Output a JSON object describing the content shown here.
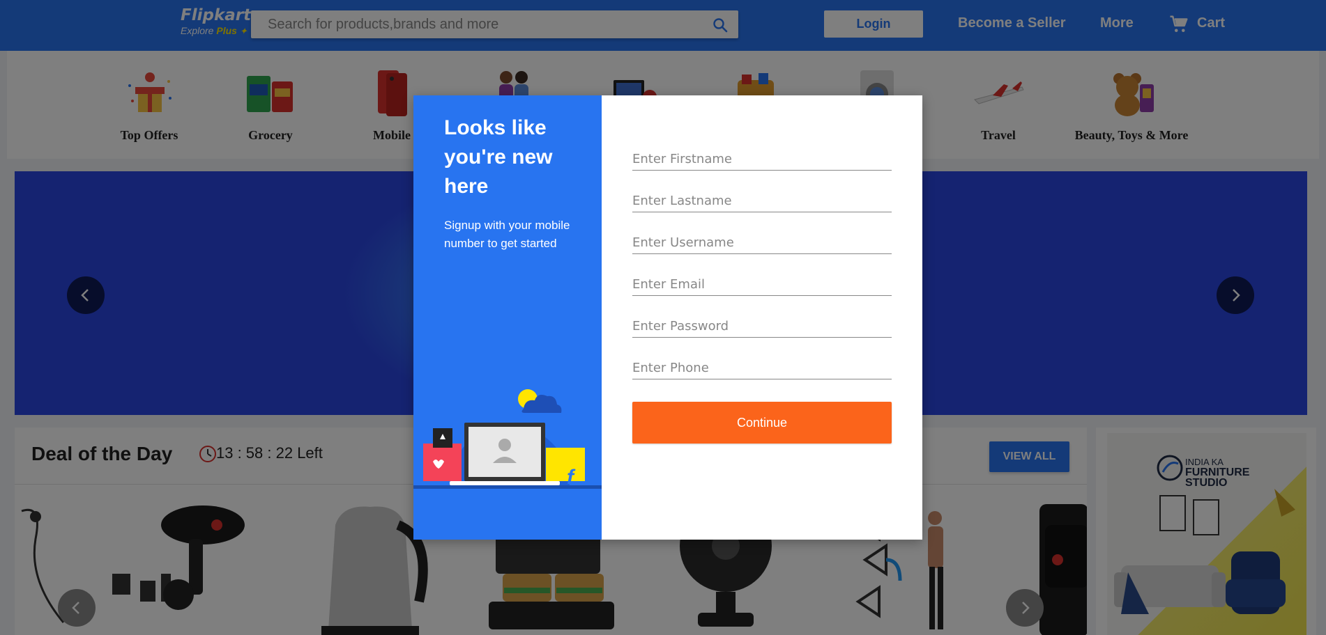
{
  "header": {
    "logo_text": "Flipkart",
    "logo_tagline_prefix": "Explore",
    "logo_tagline_plus": "Plus",
    "search_placeholder": "Search for products,brands and more",
    "login_label": "Login",
    "nav_seller": "Become a Seller",
    "nav_more": "More",
    "nav_cart": "Cart",
    "brand_color": "#2874f0"
  },
  "categories": [
    {
      "label": "Top Offers",
      "icon": "gift-icon"
    },
    {
      "label": "Grocery",
      "icon": "grocery-icon"
    },
    {
      "label": "Mobile",
      "icon": "mobile-icon"
    },
    {
      "label": "",
      "icon": "fashion-icon"
    },
    {
      "label": "",
      "icon": "electronics-icon"
    },
    {
      "label": "",
      "icon": "home-icon"
    },
    {
      "label": "",
      "icon": "appliances-icon"
    },
    {
      "label": "Travel",
      "icon": "airplane-icon"
    },
    {
      "label": "Beauty, Toys & More",
      "icon": "teddy-bear-icon"
    }
  ],
  "deals": {
    "title": "Deal of the Day",
    "timer": "13 : 58 : 22 Left",
    "view_all": "VIEW ALL"
  },
  "ad": {
    "line1": "INDIA KA",
    "line2": "FURNITURE STUDIO"
  },
  "modal": {
    "title": "Looks like you're new here",
    "subtitle": "Signup with your mobile number to get started",
    "fields": {
      "firstname": "Enter Firstname",
      "lastname": "Enter Lastname",
      "username": "Enter Username",
      "email": "Enter Email",
      "password": "Enter Password",
      "phone": "Enter Phone"
    },
    "continue_label": "Continue",
    "button_color": "#fb641b"
  }
}
